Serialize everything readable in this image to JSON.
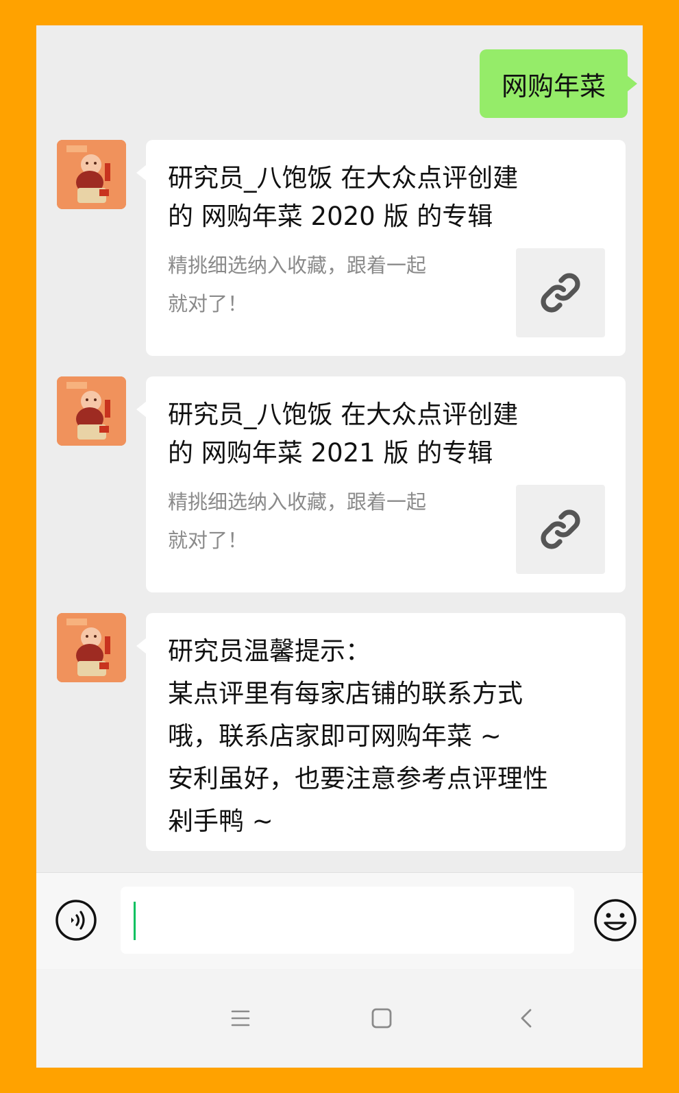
{
  "chat": {
    "sent_message": "网购年菜",
    "cards": [
      {
        "title_line1": "研究员_八饱饭 在大众点评创建",
        "title_line2": "的 网购年菜 2020 版 的专辑",
        "desc_line1": "精挑细选纳入收藏，跟着一起",
        "desc_line2": "就对了！",
        "thumb_icon": "link-icon"
      },
      {
        "title_line1": "研究员_八饱饭 在大众点评创建",
        "title_line2": "的 网购年菜 2021 版 的专辑",
        "desc_line1": "精挑细选纳入收藏，跟着一起",
        "desc_line2": "就对了！",
        "thumb_icon": "link-icon"
      }
    ],
    "tip": {
      "lines": [
        "研究员温馨提示：",
        "某点评里有每家店铺的联系方式",
        "哦，联系店家即可网购年菜 ~",
        "安利虽好，也要注意参考点评理性",
        "剁手鸭 ~"
      ]
    }
  },
  "input_bar": {
    "voice_icon": "voice-icon",
    "input_value": "",
    "emoji_icon": "emoji-icon"
  },
  "nav_bar": {
    "menu_icon": "menu-icon",
    "home_icon": "home-icon",
    "back_icon": "back-icon"
  },
  "colors": {
    "frame": "#FFA200",
    "chat_background": "#EDEDED",
    "sent_bubble": "#95EC69",
    "received_bubble": "#FFFFFF",
    "avatar": "#F0925C",
    "caret": "#07C160"
  }
}
